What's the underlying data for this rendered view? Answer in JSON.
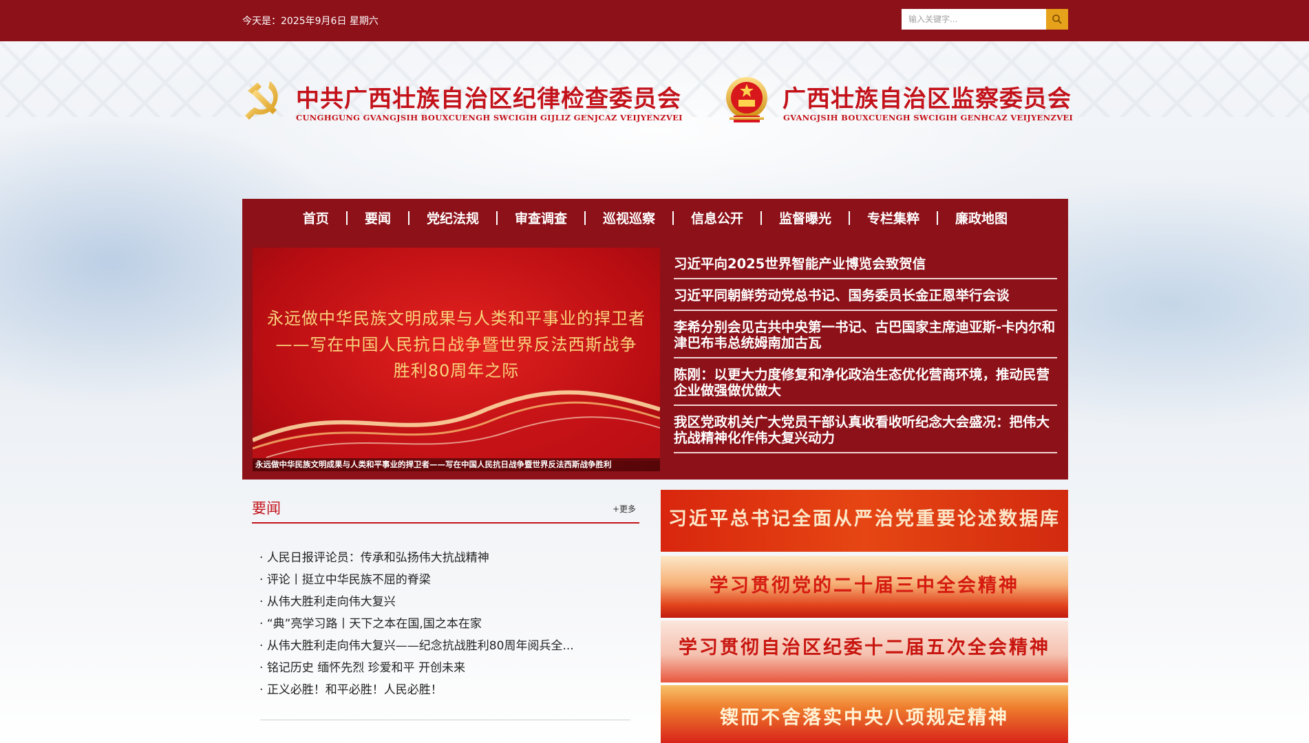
{
  "topbar": {
    "date": "今天是：2025年9月6日 星期六",
    "search_placeholder": "输入关键字..."
  },
  "header": {
    "left_title_cn": "中共广西壮族自治区纪律检查委员会",
    "left_title_en": "CUNGHGUNG GVANGJSIH BOUXCUENGH SWCIGIH GIJLIZ GENJCAZ VEIJYENZVEI",
    "right_title_cn": "广西壮族自治区监察委员会",
    "right_title_en": "GVANGJSIH BOUXCUENGH SWCIGIH GENHCAZ VEIJYENZVEI",
    "left_emblem": "party-emblem-icon",
    "right_emblem": "national-emblem-icon"
  },
  "nav": {
    "items": [
      "首页",
      "要闻",
      "党纪法规",
      "审查调查",
      "巡视巡察",
      "信息公开",
      "监督曝光",
      "专栏集粹",
      "廉政地图"
    ]
  },
  "hero": {
    "slogan_lines": [
      "永远做中华民族文明成果与人类和平事业的捍卫者",
      "——写在中国人民抗日战争暨世界反法西斯战争",
      "胜利80周年之际"
    ],
    "caption": "永远做中华民族文明成果与人类和平事业的捍卫者——写在中国人民抗日战争暨世界反法西斯战争胜利",
    "headlines": [
      "习近平向2025世界智能产业博览会致贺信",
      "习近平同朝鲜劳动党总书记、国务委员长金正恩举行会谈",
      "李希分别会见古共中央第一书记、古巴国家主席迪亚斯-卡内尔和津巴布韦总统姆南加古瓦",
      "陈刚：以更大力度修复和净化政治生态优化营商环境，推动民营企业做强做优做大",
      "我区党政机关广大党员干部认真收看收听纪念大会盛况：把伟大抗战精神化作伟大复兴动力"
    ]
  },
  "news": {
    "title": "要闻",
    "more": "+更多",
    "items": [
      "人民日报评论员：传承和弘扬伟大抗战精神",
      "评论丨挺立中华民族不屈的脊梁",
      "从伟大胜利走向伟大复兴",
      "“典”亮学习路丨天下之本在国,国之本在家",
      "从伟大胜利走向伟大复兴——纪念抗战胜利80周年阅兵全...",
      "铭记历史 缅怀先烈 珍爱和平 开创未来",
      "正义必胜！和平必胜！人民必胜！"
    ]
  },
  "banners": [
    "习近平总书记全面从严治党重要论述数据库",
    "学习贯彻党的二十届三中全会精神",
    "学习贯彻自治区纪委十二届五次全会精神",
    "锲而不舍落实中央八项规定精神"
  ],
  "colors": {
    "primary_red": "#8d1119",
    "title_red": "#c3121a",
    "search_button": "#e6a21a",
    "gold_text": "#f8d37c"
  }
}
